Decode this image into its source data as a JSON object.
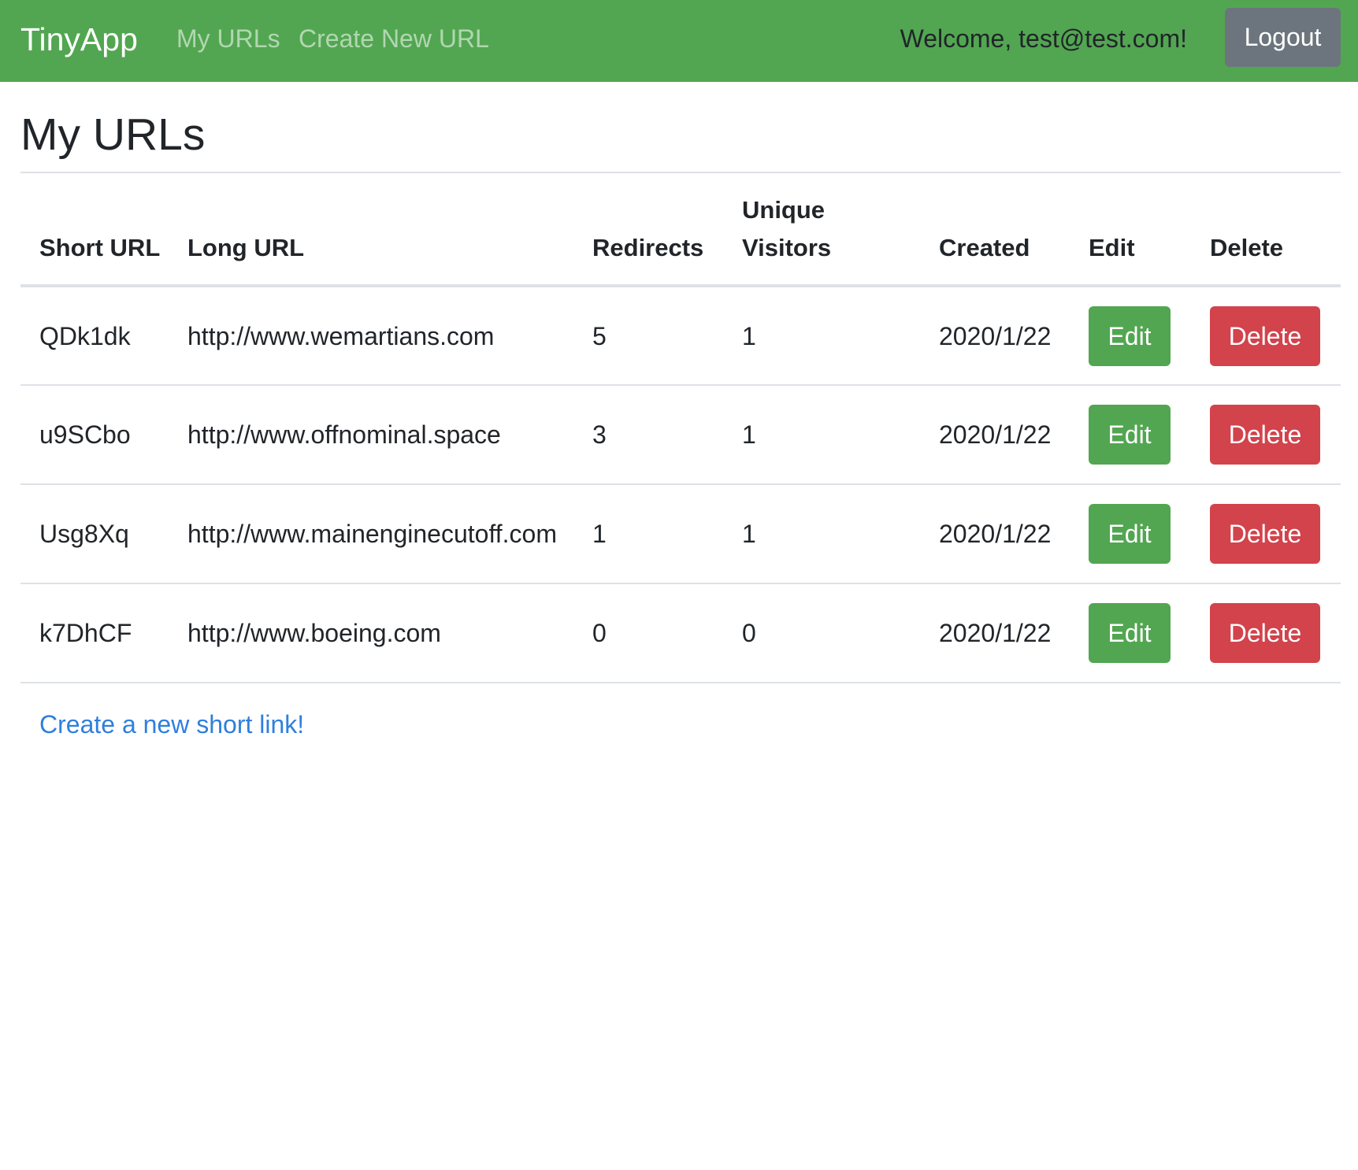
{
  "navbar": {
    "brand": "TinyApp",
    "links": [
      {
        "label": "My URLs"
      },
      {
        "label": "Create New URL"
      }
    ],
    "welcome": "Welcome, test@test.com!",
    "logout_label": "Logout"
  },
  "main": {
    "title": "My URLs",
    "table": {
      "headers": {
        "short_url": "Short URL",
        "long_url": "Long URL",
        "redirects": "Redirects",
        "unique_visitors": "Unique Visitors",
        "created": "Created",
        "edit": "Edit",
        "delete": "Delete"
      },
      "rows": [
        {
          "short": "QDk1dk",
          "long": "http://www.wemartians.com",
          "redirects": "5",
          "unique": "1",
          "created": "2020/1/22",
          "edit": "Edit",
          "delete": "Delete"
        },
        {
          "short": "u9SCbo",
          "long": "http://www.offnominal.space",
          "redirects": "3",
          "unique": "1",
          "created": "2020/1/22",
          "edit": "Edit",
          "delete": "Delete"
        },
        {
          "short": "Usg8Xq",
          "long": "http://www.mainenginecutoff.com",
          "redirects": "1",
          "unique": "1",
          "created": "2020/1/22",
          "edit": "Edit",
          "delete": "Delete"
        },
        {
          "short": "k7DhCF",
          "long": "http://www.boeing.com",
          "redirects": "0",
          "unique": "0",
          "created": "2020/1/22",
          "edit": "Edit",
          "delete": "Delete"
        }
      ]
    },
    "create_link": "Create a new short link!"
  },
  "colors": {
    "navbar_bg": "#52a651",
    "logout_bg": "#6c757d",
    "edit_bg": "#52a651",
    "delete_bg": "#d2434c",
    "link": "#2f7fde"
  }
}
